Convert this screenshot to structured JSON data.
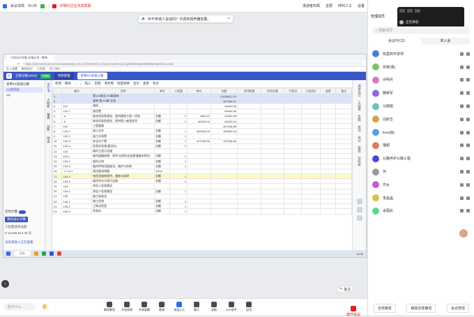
{
  "topbar": {
    "title": "会议详情",
    "time": "01:29",
    "sharing_text": "许明月正在共享屏幕",
    "speaker_label": "漫游者布局",
    "layout_label": "全屏",
    "ai_label": "呼叫人工",
    "settings_label": "设置"
  },
  "notice": {
    "text": "听不到他人说话吗？可调高扬声器音量。"
  },
  "browser": {
    "tab": "大邦设计创意-宏福分享 - 翰林…",
    "url": "https://dsk.smartcost.com.cn/subject/cdf_ver-641/3994bb/xzc_book?nodeID=Qz-ayhtDMDesignMtrNBIdbrightlOw=value",
    "bookmarks": [
      "导入收藏",
      "翰林造价",
      "工程表",
      "网上报价"
    ]
  },
  "app": {
    "logo": "C",
    "tabs": [
      "全部记账(2018)",
      "项目管理",
      "甘霖XX高速公路"
    ],
    "badge": "升级版"
  },
  "leftpane": {
    "project": "甘肃XX高速公路",
    "rows": [
      "A2合同段",
      "A3"
    ],
    "toggle_label": "实时计算",
    "tag": "我的总价计算",
    "total_label": "工程量清单总额",
    "total_amount": "¥ 13,455,813.29 元",
    "net_status": "没有其他人正在查看"
  },
  "sidetabs": [
    "造价书",
    "人材机",
    "报表",
    "分析",
    "导出"
  ],
  "toolbar": {
    "items": [
      "新建",
      "删除",
      "↑",
      "↓",
      "插入",
      "定额",
      "清单库",
      "批量替换",
      "显示",
      "查看",
      "更多"
    ]
  },
  "grid": {
    "columns": [
      "",
      "编号",
      "名称",
      "单位",
      "工程量",
      "单价",
      "金额",
      "合同数量",
      "合同金额",
      "不变动",
      "工程造价",
      "变更",
      "备注"
    ],
    "rows": [
      {
        "n": "1",
        "code": "-",
        "name": "第100章至700章清单",
        "unit": "",
        "qty": "",
        "price": "",
        "amount": "13438813.29",
        "cls": "hl"
      },
      {
        "n": "2",
        "code": "-",
        "name": "清单 第100章 总则",
        "unit": "",
        "qty": "",
        "price": "",
        "amount": "397356.21",
        "cls": "hl"
      },
      {
        "n": "3",
        "code": "101",
        "name": "通则",
        "unit": "",
        "qty": "",
        "price": "",
        "amount": "99409.35",
        "cls": ""
      },
      {
        "n": "4",
        "code": "101-1",
        "name": "保险费",
        "unit": "",
        "qty": "",
        "price": "",
        "amount": "99409.35",
        "cls": ""
      },
      {
        "n": "5",
        "code": "-a",
        "name": "按合同条款规定，提供建筑工程一切险",
        "unit": "总额",
        "qty": "1",
        "price": "1581.97",
        "amount": "39409.35",
        "cls": ""
      },
      {
        "n": "6",
        "code": "-b",
        "name": "按合同条款规定，提供第三者责任险",
        "unit": "总额",
        "qty": "1",
        "price": "60000.00",
        "amount": "60000.00",
        "cls": ""
      },
      {
        "n": "7",
        "code": "102",
        "name": "工程管理",
        "unit": "",
        "qty": "",
        "price": "",
        "amount": "497946.86",
        "cls": ""
      },
      {
        "n": "8",
        "code": "102-1",
        "name": "竣工文件",
        "unit": "总额",
        "qty": "1",
        "price": "300000.00",
        "amount": "300000.00",
        "cls": ""
      },
      {
        "n": "9",
        "code": "102-2",
        "name": "施工环保费",
        "unit": "总额",
        "qty": "1",
        "price": "",
        "amount": "",
        "cls": ""
      },
      {
        "n": "10",
        "code": "102-3",
        "name": "安全生产费",
        "unit": "总额",
        "qty": "1",
        "price": "197946.86",
        "amount": "197946.86",
        "cls": ""
      },
      {
        "n": "11",
        "code": "102-4",
        "name": "信息化系统(暂估价)",
        "unit": "总额",
        "qty": "1",
        "price": "",
        "amount": "",
        "cls": ""
      },
      {
        "n": "12",
        "code": "103",
        "name": "临时工程与设施",
        "unit": "",
        "qty": "",
        "price": "",
        "amount": "",
        "cls": ""
      },
      {
        "n": "13",
        "code": "103-1",
        "name": "临时道路修建、养护与拆除(包括原道路的养护)",
        "unit": "总额",
        "qty": "1",
        "price": "",
        "amount": "",
        "cls": ""
      },
      {
        "n": "14",
        "code": "103-2",
        "name": "临时占地",
        "unit": "总额",
        "qty": "1",
        "price": "",
        "amount": "",
        "cls": ""
      },
      {
        "n": "15",
        "code": "103-3",
        "name": "临时供电设施架设、维护与拆除",
        "unit": "总额",
        "qty": "1",
        "price": "",
        "amount": "",
        "cls": ""
      },
      {
        "n": "16",
        "code": "-7.1.6-1",
        "name": "高边坡电线路",
        "unit": "100m",
        "qty": "",
        "price": "",
        "amount": "",
        "cls": ""
      },
      {
        "n": "17",
        "code": "103-4",
        "name": "电信设施的提供、维修与拆除",
        "unit": "总额",
        "qty": "1",
        "price": "",
        "amount": "",
        "cls": "yl"
      },
      {
        "n": "18",
        "code": "103-5",
        "name": "临时供水与排污设施",
        "unit": "总额",
        "qty": "1",
        "price": "",
        "amount": "",
        "cls": ""
      },
      {
        "n": "19",
        "code": "104",
        "name": "承包人驻地建设",
        "unit": "",
        "qty": "",
        "price": "",
        "amount": "",
        "cls": ""
      },
      {
        "n": "20",
        "code": "104-1",
        "name": "承包人驻地建设",
        "unit": "总额",
        "qty": "1",
        "price": "",
        "amount": "",
        "cls": ""
      },
      {
        "n": "21",
        "code": "105",
        "name": "施工标准化",
        "unit": "",
        "qty": "",
        "price": "",
        "amount": "",
        "cls": ""
      },
      {
        "n": "22",
        "code": "105-1",
        "name": "施工驻地",
        "unit": "总额",
        "qty": "1",
        "price": "",
        "amount": "",
        "cls": ""
      },
      {
        "n": "23",
        "code": "105-2",
        "name": "工地试验室",
        "unit": "总额",
        "qty": "1",
        "price": "",
        "amount": "",
        "cls": ""
      },
      {
        "n": "24",
        "code": "105-3",
        "name": "拌和站",
        "unit": "总额",
        "qty": "1",
        "price": "",
        "amount": "",
        "cls": ""
      }
    ]
  },
  "rightpane": [
    "清单指引",
    "工程量",
    "定额",
    "批注",
    "日记",
    "属性",
    "资料库"
  ],
  "taskbar": {
    "search": "搜索",
    "clock": "14:05"
  },
  "comment_btn": "批注",
  "bottombar": {
    "chat_placeholder": "说点什么…",
    "controls": [
      "解除静音",
      "开启视频",
      "共享屏幕",
      "邀请",
      "成员(12)",
      "聊天",
      "录制",
      "AI小助手",
      "应用"
    ],
    "leave": "离开会议"
  },
  "rpanel": {
    "title": "管理成员",
    "pop_status": "正在讲话:",
    "search_placeholder": "搜索成员",
    "tabs": [
      "会议中(12)",
      "未入会"
    ],
    "members": [
      {
        "name": "陈墨软件讲师",
        "color": "#4a7bd8"
      },
      {
        "name": "甘蔗(我)",
        "color": "#7cc46b"
      },
      {
        "name": "许明月",
        "color": "#d87ab0"
      },
      {
        "name": "魏荣军",
        "color": "#8a6ad8"
      },
      {
        "name": "马丽丽",
        "color": "#6bc4b9"
      },
      {
        "name": "闫昕华",
        "color": "#d8a04a"
      },
      {
        "name": "free(我)",
        "color": "#5aa0e0"
      },
      {
        "name": "猫甜",
        "color": "#e07a5a"
      },
      {
        "name": "公路养护公路工程",
        "color": "#4a4ad8"
      },
      {
        "name": "何",
        "color": "#9a9a9a"
      },
      {
        "name": "齐女",
        "color": "#c45ad8"
      },
      {
        "name": "李晶晶",
        "color": "#d8c04a"
      },
      {
        "name": "采尾彩",
        "color": "#5ad88a"
      }
    ],
    "buttons": [
      "全体静音",
      "解除全体静音",
      "会议管控"
    ]
  }
}
